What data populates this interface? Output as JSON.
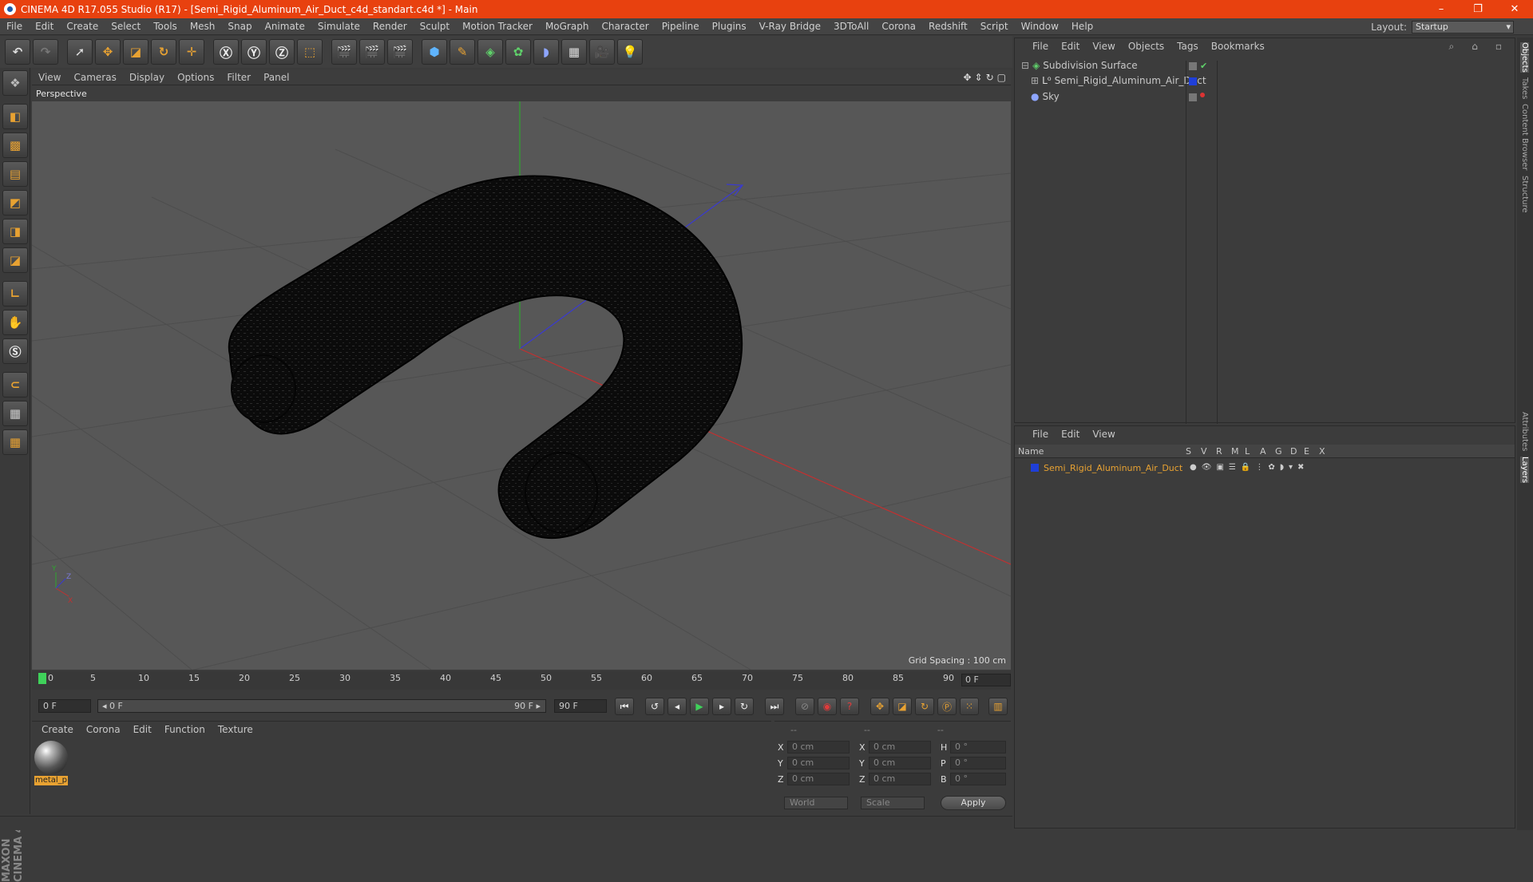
{
  "window": {
    "title": "CINEMA 4D R17.055 Studio (R17) - [Semi_Rigid_Aluminum_Air_Duct_c4d_standart.c4d *] - Main",
    "controls": [
      "–",
      "❐",
      "✕"
    ]
  },
  "menu": [
    "File",
    "Edit",
    "Create",
    "Select",
    "Tools",
    "Mesh",
    "Snap",
    "Animate",
    "Simulate",
    "Render",
    "Sculpt",
    "Motion Tracker",
    "MoGraph",
    "Character",
    "Pipeline",
    "Plugins",
    "V-Ray Bridge",
    "3DToAll",
    "Corona",
    "Redshift",
    "Script",
    "Window",
    "Help"
  ],
  "layout": {
    "label": "Layout:",
    "value": "Startup"
  },
  "viewport": {
    "menu": [
      "View",
      "Cameras",
      "Display",
      "Options",
      "Filter",
      "Panel"
    ],
    "label": "Perspective",
    "grid_spacing": "Grid Spacing : 100 cm",
    "axis_labels": {
      "y": "Y",
      "z": "Z",
      "x": "X"
    }
  },
  "timeline": {
    "ticks": [
      "0",
      "5",
      "10",
      "15",
      "20",
      "25",
      "30",
      "35",
      "40",
      "45",
      "50",
      "55",
      "60",
      "65",
      "70",
      "75",
      "80",
      "85",
      "90"
    ],
    "current_frame": "0 F"
  },
  "playback": {
    "start": "0 F",
    "range_start": "◂ 0 F",
    "range_end": "90 F ▸",
    "end": "90 F"
  },
  "material_panel": {
    "menu": [
      "Create",
      "Corona",
      "Edit",
      "Function",
      "Texture"
    ],
    "material_name": "metal_p"
  },
  "coordinates": {
    "header": [
      "--",
      "--",
      "--"
    ],
    "rows": [
      {
        "a": "X",
        "av": "0 cm",
        "b": "X",
        "bv": "0 cm",
        "c": "H",
        "cv": "0 °"
      },
      {
        "a": "Y",
        "av": "0 cm",
        "b": "Y",
        "bv": "0 cm",
        "c": "P",
        "cv": "0 °"
      },
      {
        "a": "Z",
        "av": "0 cm",
        "b": "Z",
        "bv": "0 cm",
        "c": "B",
        "cv": "0 °"
      }
    ],
    "world": "World",
    "scale": "Scale",
    "apply": "Apply"
  },
  "objects_panel": {
    "menu": [
      "File",
      "Edit",
      "View",
      "Objects",
      "Tags",
      "Bookmarks"
    ],
    "items": [
      "Subdivision Surface",
      "Semi_Rigid_Aluminum_Air_Duct",
      "Sky"
    ]
  },
  "layers_panel": {
    "menu": [
      "File",
      "Edit",
      "View"
    ],
    "columns": [
      "Name",
      "S",
      "V",
      "R",
      "M",
      "L",
      "A",
      "G",
      "D",
      "E",
      "X"
    ],
    "layer_name": "Semi_Rigid_Aluminum_Air_Duct"
  },
  "right_tabs": [
    "Objects",
    "Takes",
    "Content Browser",
    "Structure",
    "Attributes",
    "Layers"
  ],
  "branding": "MAXON CINEMA 4D",
  "colors": {
    "accent": "#e8410f",
    "highlight": "#e8a232",
    "layer_blue": "#1f3fd8"
  }
}
